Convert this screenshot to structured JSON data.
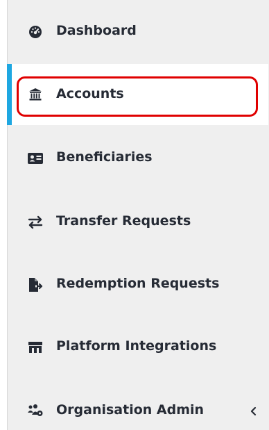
{
  "sidebar": {
    "accent_color": "#1ea7e1",
    "highlight_color": "#e00000",
    "items": [
      {
        "label": "Dashboard",
        "icon": "dashboard-gauge-icon",
        "active": false
      },
      {
        "label": "Accounts",
        "icon": "bank-icon",
        "active": true
      },
      {
        "label": "Beneficiaries",
        "icon": "id-card-icon",
        "active": false
      },
      {
        "label": "Transfer Requests",
        "icon": "transfer-arrows-icon",
        "active": false
      },
      {
        "label": "Redemption Requests",
        "icon": "file-export-icon",
        "active": false
      },
      {
        "label": "Platform Integrations",
        "icon": "integration-icon",
        "active": false
      },
      {
        "label": "Organisation Admin",
        "icon": "users-cog-icon",
        "active": false,
        "expandable": true,
        "expand_icon": "chevron-left-icon"
      }
    ]
  }
}
